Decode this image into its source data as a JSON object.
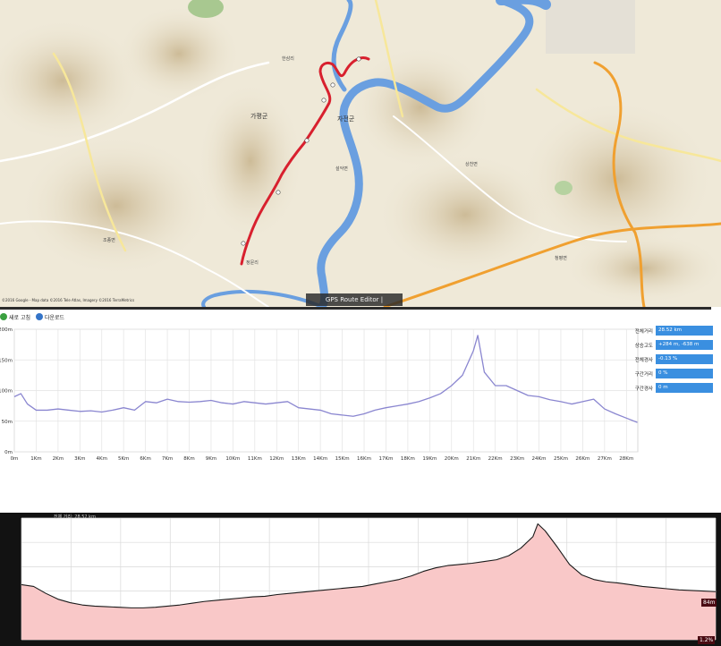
{
  "map": {
    "footer_text": "GPS Route Editor | www.gpsnote.net",
    "copyright": "©2016 Google - Map data ©2016 Tele Atlas, Imagery ©2016 TerraMetrics",
    "labels": {
      "gapyeong": "가평군",
      "town": "자전군",
      "place_a": "정문리",
      "place_b": "한삼리",
      "place_c": "상천면",
      "place_d": "청평면",
      "place_e": "조종면",
      "place_f": "설악면"
    },
    "colors": {
      "route": "#d8202e",
      "river": "#6a9fe0",
      "highway": "#f0a030",
      "road": "#ffffff"
    }
  },
  "toolbar": {
    "refresh_label": "새로 고침",
    "download_label": "다운로드"
  },
  "stats": [
    {
      "label": "전체거리",
      "value": "28.52 km"
    },
    {
      "label": "상승고도",
      "value": "+284 m, -638 m"
    },
    {
      "label": "전체경사",
      "value": "-0.13 %"
    },
    {
      "label": "구간거리",
      "value": "0 %"
    },
    {
      "label": "구간경사",
      "value": "0 m"
    }
  ],
  "chart_data": [
    {
      "type": "line",
      "title": "",
      "xlabel": "",
      "ylabel": "",
      "x_ticks": [
        "0m",
        "1Km",
        "2Km",
        "3Km",
        "4Km",
        "5Km",
        "6Km",
        "7Km",
        "8Km",
        "9Km",
        "10Km",
        "11Km",
        "12Km",
        "13Km",
        "14Km",
        "15Km",
        "16Km",
        "17Km",
        "18Km",
        "19Km",
        "20Km",
        "21Km",
        "22Km",
        "23Km",
        "24Km",
        "25Km",
        "26Km",
        "27Km",
        "28Km"
      ],
      "y_ticks": [
        "0m",
        "50m",
        "100m",
        "150m",
        "200m"
      ],
      "xlim": [
        0,
        28.52
      ],
      "ylim": [
        0,
        200
      ],
      "grid": true,
      "line_color": "#8a86d0",
      "series": [
        {
          "x": [
            0,
            0.3,
            0.6,
            1.0,
            1.5,
            2,
            2.5,
            3,
            3.5,
            4,
            4.5,
            5,
            5.5,
            6,
            6.5,
            7,
            7.5,
            8,
            8.5,
            9,
            9.5,
            10,
            10.5,
            11,
            11.5,
            12,
            12.5,
            13,
            13.5,
            14,
            14.5,
            15,
            15.5,
            16,
            16.5,
            17,
            17.5,
            18,
            18.5,
            19,
            19.5,
            20,
            20.5,
            21,
            21.2,
            21.5,
            22,
            22.5,
            23,
            23.5,
            24,
            24.5,
            25,
            25.5,
            26,
            26.5,
            27,
            27.5,
            28,
            28.5
          ],
          "y": [
            90,
            95,
            78,
            68,
            68,
            70,
            68,
            66,
            67,
            65,
            68,
            72,
            68,
            82,
            80,
            86,
            82,
            81,
            82,
            84,
            80,
            78,
            82,
            80,
            78,
            80,
            82,
            72,
            70,
            68,
            62,
            60,
            58,
            62,
            68,
            72,
            75,
            78,
            82,
            88,
            95,
            108,
            125,
            165,
            190,
            130,
            108,
            108,
            100,
            92,
            90,
            85,
            82,
            78,
            82,
            86,
            70,
            62,
            55,
            48
          ]
        }
      ]
    },
    {
      "type": "area",
      "title": "",
      "xlabel": "",
      "ylabel": "",
      "fill_color": "#f9c8c8",
      "line_color": "#1a1a1a",
      "series": [
        {
          "x": [
            0,
            0.5,
            1,
            1.5,
            2,
            2.5,
            3,
            3.5,
            4,
            4.5,
            5,
            5.5,
            6,
            6.5,
            7,
            7.5,
            8,
            8.5,
            9,
            9.5,
            10,
            10.5,
            11,
            11.5,
            12,
            12.5,
            13,
            13.5,
            14,
            14.5,
            15,
            15.5,
            16,
            16.5,
            17,
            17.5,
            18,
            18.5,
            19,
            19.5,
            20,
            20.5,
            21,
            21.2,
            21.5,
            22,
            22.5,
            23,
            23.5,
            24,
            24.5,
            25,
            25.5,
            26,
            26.5,
            27,
            27.5,
            28,
            28.5
          ],
          "y": [
            95,
            92,
            80,
            70,
            64,
            60,
            58,
            57,
            56,
            55,
            55,
            56,
            58,
            60,
            63,
            66,
            68,
            70,
            72,
            74,
            75,
            78,
            80,
            82,
            84,
            86,
            88,
            90,
            92,
            96,
            100,
            104,
            110,
            118,
            124,
            128,
            130,
            132,
            135,
            138,
            145,
            158,
            178,
            200,
            188,
            160,
            130,
            112,
            104,
            100,
            98,
            95,
            92,
            90,
            88,
            86,
            85,
            84,
            83
          ]
        }
      ],
      "top_label_text": "전체 거리: 28.52 km",
      "right_badge": "84m",
      "bottom_badge": "1.2%"
    }
  ]
}
